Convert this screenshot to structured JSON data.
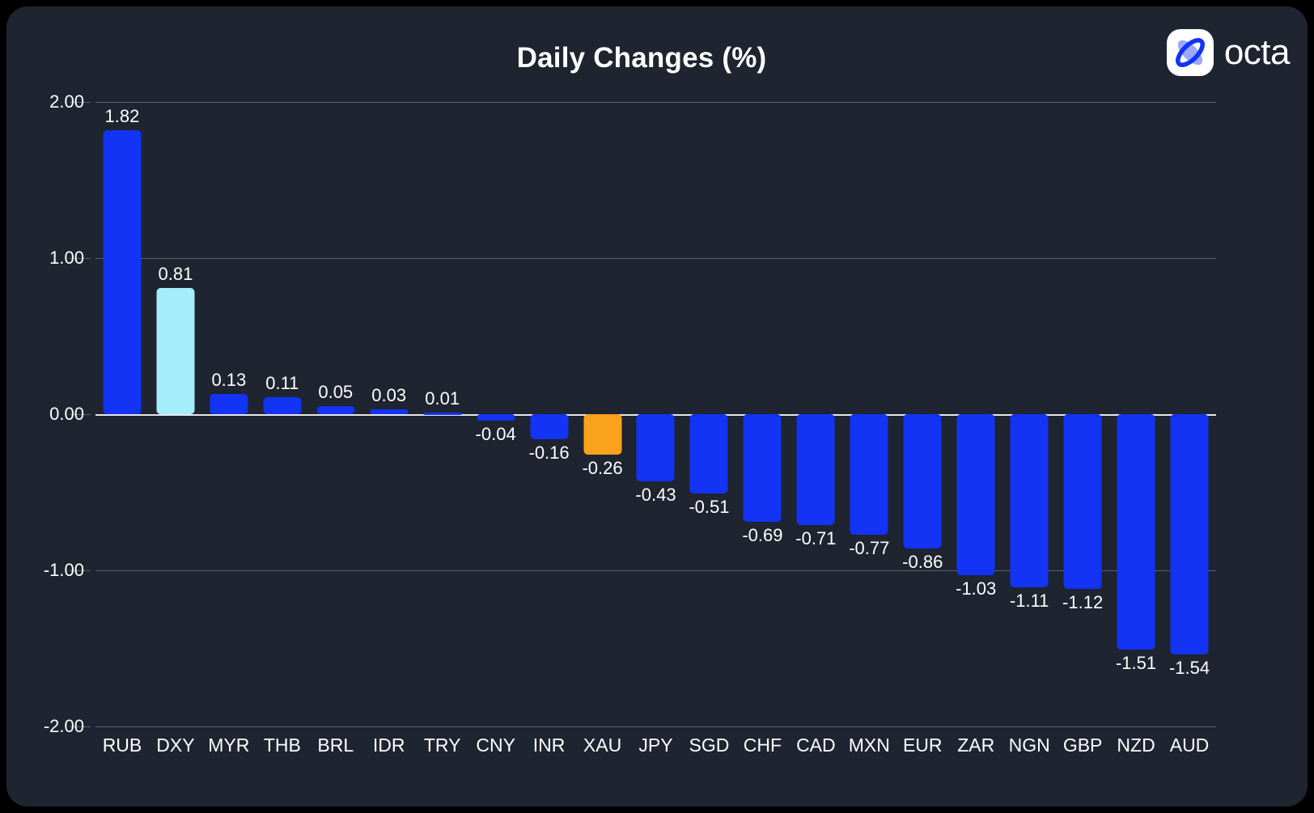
{
  "header": {
    "title": "Daily Changes (%)",
    "brand": "octa",
    "logo_icon": "octa-x-logo-icon"
  },
  "colors": {
    "background": "#1e2430",
    "page": "#000000",
    "bar_default": "#1333f5",
    "bar_highlight_cyan": "#a5edfb",
    "bar_highlight_orange": "#faa21b",
    "grid": "#5a6070",
    "zero_line": "#e8e8ea",
    "text": "#ffffff"
  },
  "chart_data": {
    "type": "bar",
    "title": "Daily Changes (%)",
    "xlabel": "",
    "ylabel": "",
    "ylim": [
      -2.0,
      2.0
    ],
    "yticks": [
      "2.00",
      "1.00",
      "0.00",
      "-1.00",
      "-2.00"
    ],
    "ytick_values": [
      2.0,
      1.0,
      0.0,
      -1.0,
      -2.0
    ],
    "grid": true,
    "legend": null,
    "categories": [
      "RUB",
      "DXY",
      "MYR",
      "THB",
      "BRL",
      "IDR",
      "TRY",
      "CNY",
      "INR",
      "XAU",
      "JPY",
      "SGD",
      "CHF",
      "CAD",
      "MXN",
      "EUR",
      "ZAR",
      "NGN",
      "GBP",
      "NZD",
      "AUD"
    ],
    "values": [
      1.82,
      0.81,
      0.13,
      0.11,
      0.05,
      0.03,
      0.01,
      -0.04,
      -0.16,
      -0.26,
      -0.43,
      -0.51,
      -0.69,
      -0.71,
      -0.77,
      -0.86,
      -1.03,
      -1.11,
      -1.12,
      -1.51,
      -1.54
    ],
    "labels": [
      "1.82",
      "0.81",
      "0.13",
      "0.11",
      "0.05",
      "0.03",
      "0.01",
      "-0.04",
      "-0.16",
      "-0.26",
      "-0.43",
      "-0.51",
      "-0.69",
      "-0.71",
      "-0.77",
      "-0.86",
      "-1.03",
      "-1.11",
      "-1.12",
      "-1.51",
      "-1.54"
    ],
    "bar_colors": [
      "#1333f5",
      "#a5edfb",
      "#1333f5",
      "#1333f5",
      "#1333f5",
      "#1333f5",
      "#1333f5",
      "#1333f5",
      "#1333f5",
      "#faa21b",
      "#1333f5",
      "#1333f5",
      "#1333f5",
      "#1333f5",
      "#1333f5",
      "#1333f5",
      "#1333f5",
      "#1333f5",
      "#1333f5",
      "#1333f5",
      "#1333f5"
    ]
  }
}
